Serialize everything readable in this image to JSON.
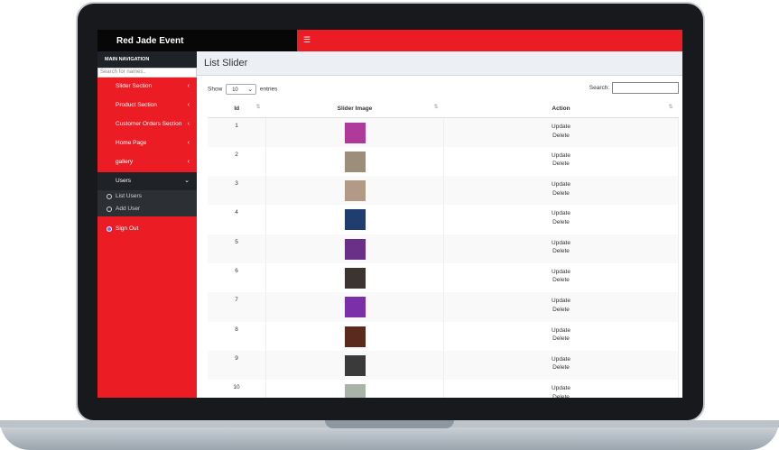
{
  "app": {
    "brand": "Red Jade Event",
    "menu_icon": "hamburger-icon"
  },
  "sidebar": {
    "header": "MAIN NAVIGATION",
    "search_placeholder": "Search for names..",
    "items": [
      {
        "label": "Slider Section",
        "chevron": "‹"
      },
      {
        "label": "Product Section",
        "chevron": "‹"
      },
      {
        "label": "Customer Orders Section",
        "chevron": "‹"
      },
      {
        "label": "Home Page",
        "chevron": "‹"
      },
      {
        "label": "gallery",
        "chevron": "‹"
      },
      {
        "label": "Users",
        "chevron": "⌄"
      }
    ],
    "sub_items": [
      {
        "label": "List Users"
      },
      {
        "label": "Add User"
      }
    ],
    "sign_out": "Sign Out"
  },
  "page": {
    "title": "List Slider",
    "show_label": "Show",
    "entries_value": "10",
    "entries_label": "entries",
    "search_label": "Search:"
  },
  "table": {
    "headers": [
      "Id",
      "Slider Image",
      "Action"
    ],
    "update_label": "Update",
    "delete_label": "Delete",
    "rows": [
      {
        "id": "1",
        "color": "#b03a9a"
      },
      {
        "id": "2",
        "color": "#9c8e7a"
      },
      {
        "id": "3",
        "color": "#b39a86"
      },
      {
        "id": "4",
        "color": "#1f3d6e"
      },
      {
        "id": "5",
        "color": "#6a2f86"
      },
      {
        "id": "6",
        "color": "#3b3430"
      },
      {
        "id": "7",
        "color": "#7b2fa8"
      },
      {
        "id": "8",
        "color": "#5a2a1e"
      },
      {
        "id": "9",
        "color": "#3a3a3a"
      },
      {
        "id": "10",
        "color": "#a9b3a7"
      }
    ]
  }
}
